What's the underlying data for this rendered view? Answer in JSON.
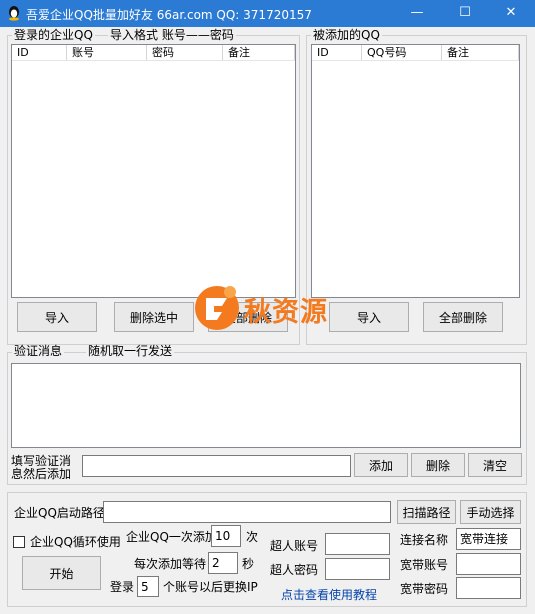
{
  "window": {
    "title": "吾爱企业QQ批量加好友    66ar.com QQ: 371720157",
    "minimize": "—",
    "maximize": "☐",
    "close": "✕"
  },
  "login_group": {
    "label": "登录的企业QQ",
    "format_hint": "导入格式  账号——密码",
    "columns": [
      "ID",
      "账号",
      "密码",
      "备注"
    ],
    "buttons": {
      "import": "导入",
      "delete_selected": "删除选中",
      "delete_all": "全部删除"
    }
  },
  "added_group": {
    "label": "被添加的QQ",
    "columns": [
      "ID",
      "QQ号码",
      "备注"
    ],
    "buttons": {
      "import": "导入",
      "delete_all": "全部删除"
    }
  },
  "verify_group": {
    "label": "验证消息",
    "hint": "随机取一行发送",
    "fill_label_line1": "填写验证消",
    "fill_label_line2": "息然后添加",
    "input_value": "",
    "buttons": {
      "add": "添加",
      "delete": "删除",
      "clear": "清空"
    }
  },
  "settings": {
    "path_label": "企业QQ启动路径",
    "path_value": "",
    "scan_button": "扫描路径",
    "manual_button": "手动选择",
    "loop_label": "企业QQ循环使用",
    "loop_checked": false,
    "start_button": "开始",
    "per_add_label": "企业QQ一次添加",
    "per_add_value": "10",
    "per_add_unit": "次",
    "wait_label": "每次添加等待",
    "wait_value": "2",
    "wait_unit": "秒",
    "login_label": "登录",
    "login_value": "5",
    "login_suffix": "个账号以后更换IP",
    "super_account_label": "超人账号",
    "super_account_value": "",
    "super_password_label": "超人密码",
    "super_password_value": "",
    "connection_name_label": "连接名称",
    "connection_name_value": "宽带连接",
    "broadband_account_label": "宽带账号",
    "broadband_account_value": "",
    "broadband_password_label": "宽带密码",
    "broadband_password_value": "",
    "tutorial_link": "点击查看使用教程"
  },
  "watermark": {
    "text": "秋资源",
    "color": "#f47a20"
  },
  "colors": {
    "titlebar": "#2b7ad3",
    "link": "#0645ad"
  }
}
